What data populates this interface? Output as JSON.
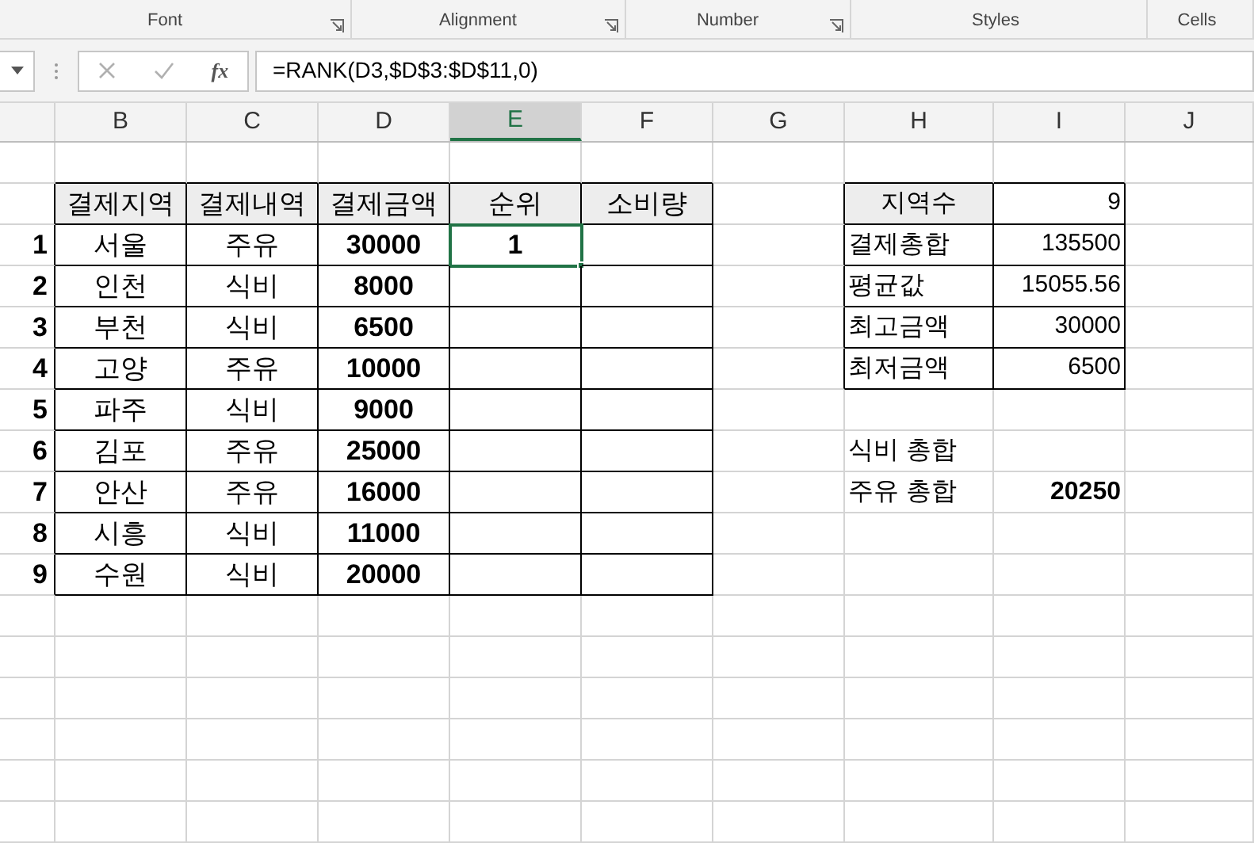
{
  "ribbon": {
    "groups": [
      {
        "label": "Font",
        "launcher": true
      },
      {
        "label": "Alignment",
        "launcher": true
      },
      {
        "label": "Number",
        "launcher": true
      },
      {
        "label": "Styles",
        "launcher": false
      },
      {
        "label": "Cells",
        "launcher": false
      }
    ]
  },
  "formula_bar": {
    "fx_label": "fx",
    "formula": "=RANK(D3,$D$3:$D$11,0)"
  },
  "column_headers": [
    {
      "label": "B",
      "selected": false
    },
    {
      "label": "C",
      "selected": false
    },
    {
      "label": "D",
      "selected": false
    },
    {
      "label": "E",
      "selected": true
    },
    {
      "label": "F",
      "selected": false
    },
    {
      "label": "G",
      "selected": false
    },
    {
      "label": "H",
      "selected": false
    },
    {
      "label": "I",
      "selected": false
    },
    {
      "label": "J",
      "selected": false
    }
  ],
  "table": {
    "columns": [
      "결제지역",
      "결제내역",
      "결제금액",
      "순위",
      "소비량"
    ],
    "rows": [
      {
        "number": "1",
        "region": "서울",
        "item": "주유",
        "amount": "30000",
        "rank": "1",
        "rank_selected": true
      },
      {
        "number": "2",
        "region": "인천",
        "item": "식비",
        "amount": "8000",
        "rank_selected": false
      },
      {
        "number": "3",
        "region": "부천",
        "item": "식비",
        "amount": "6500",
        "rank_selected": false
      },
      {
        "number": "4",
        "region": "고양",
        "item": "주유",
        "amount": "10000",
        "rank_selected": false
      },
      {
        "number": "5",
        "region": "파주",
        "item": "식비",
        "amount": "9000",
        "rank_selected": false
      },
      {
        "number": "6",
        "region": "김포",
        "item": "주유",
        "amount": "25000",
        "rank_selected": false
      },
      {
        "number": "7",
        "region": "안산",
        "item": "주유",
        "amount": "16000",
        "rank_selected": false
      },
      {
        "number": "8",
        "region": "시흥",
        "item": "식비",
        "amount": "11000",
        "rank_selected": false
      },
      {
        "number": "9",
        "region": "수원",
        "item": "식비",
        "amount": "20000",
        "rank_selected": false
      }
    ]
  },
  "summary": [
    {
      "label": "지역수",
      "value": "9"
    },
    {
      "label": "결제총합",
      "value": "135500"
    },
    {
      "label": "평균값",
      "value": "15055.56"
    },
    {
      "label": "최고금액",
      "value": "30000"
    },
    {
      "label": "최저금액",
      "value": "6500"
    }
  ],
  "totals": [
    {
      "label": "식비 총합"
    },
    {
      "label": "주유 총합",
      "value": "20250"
    }
  ]
}
